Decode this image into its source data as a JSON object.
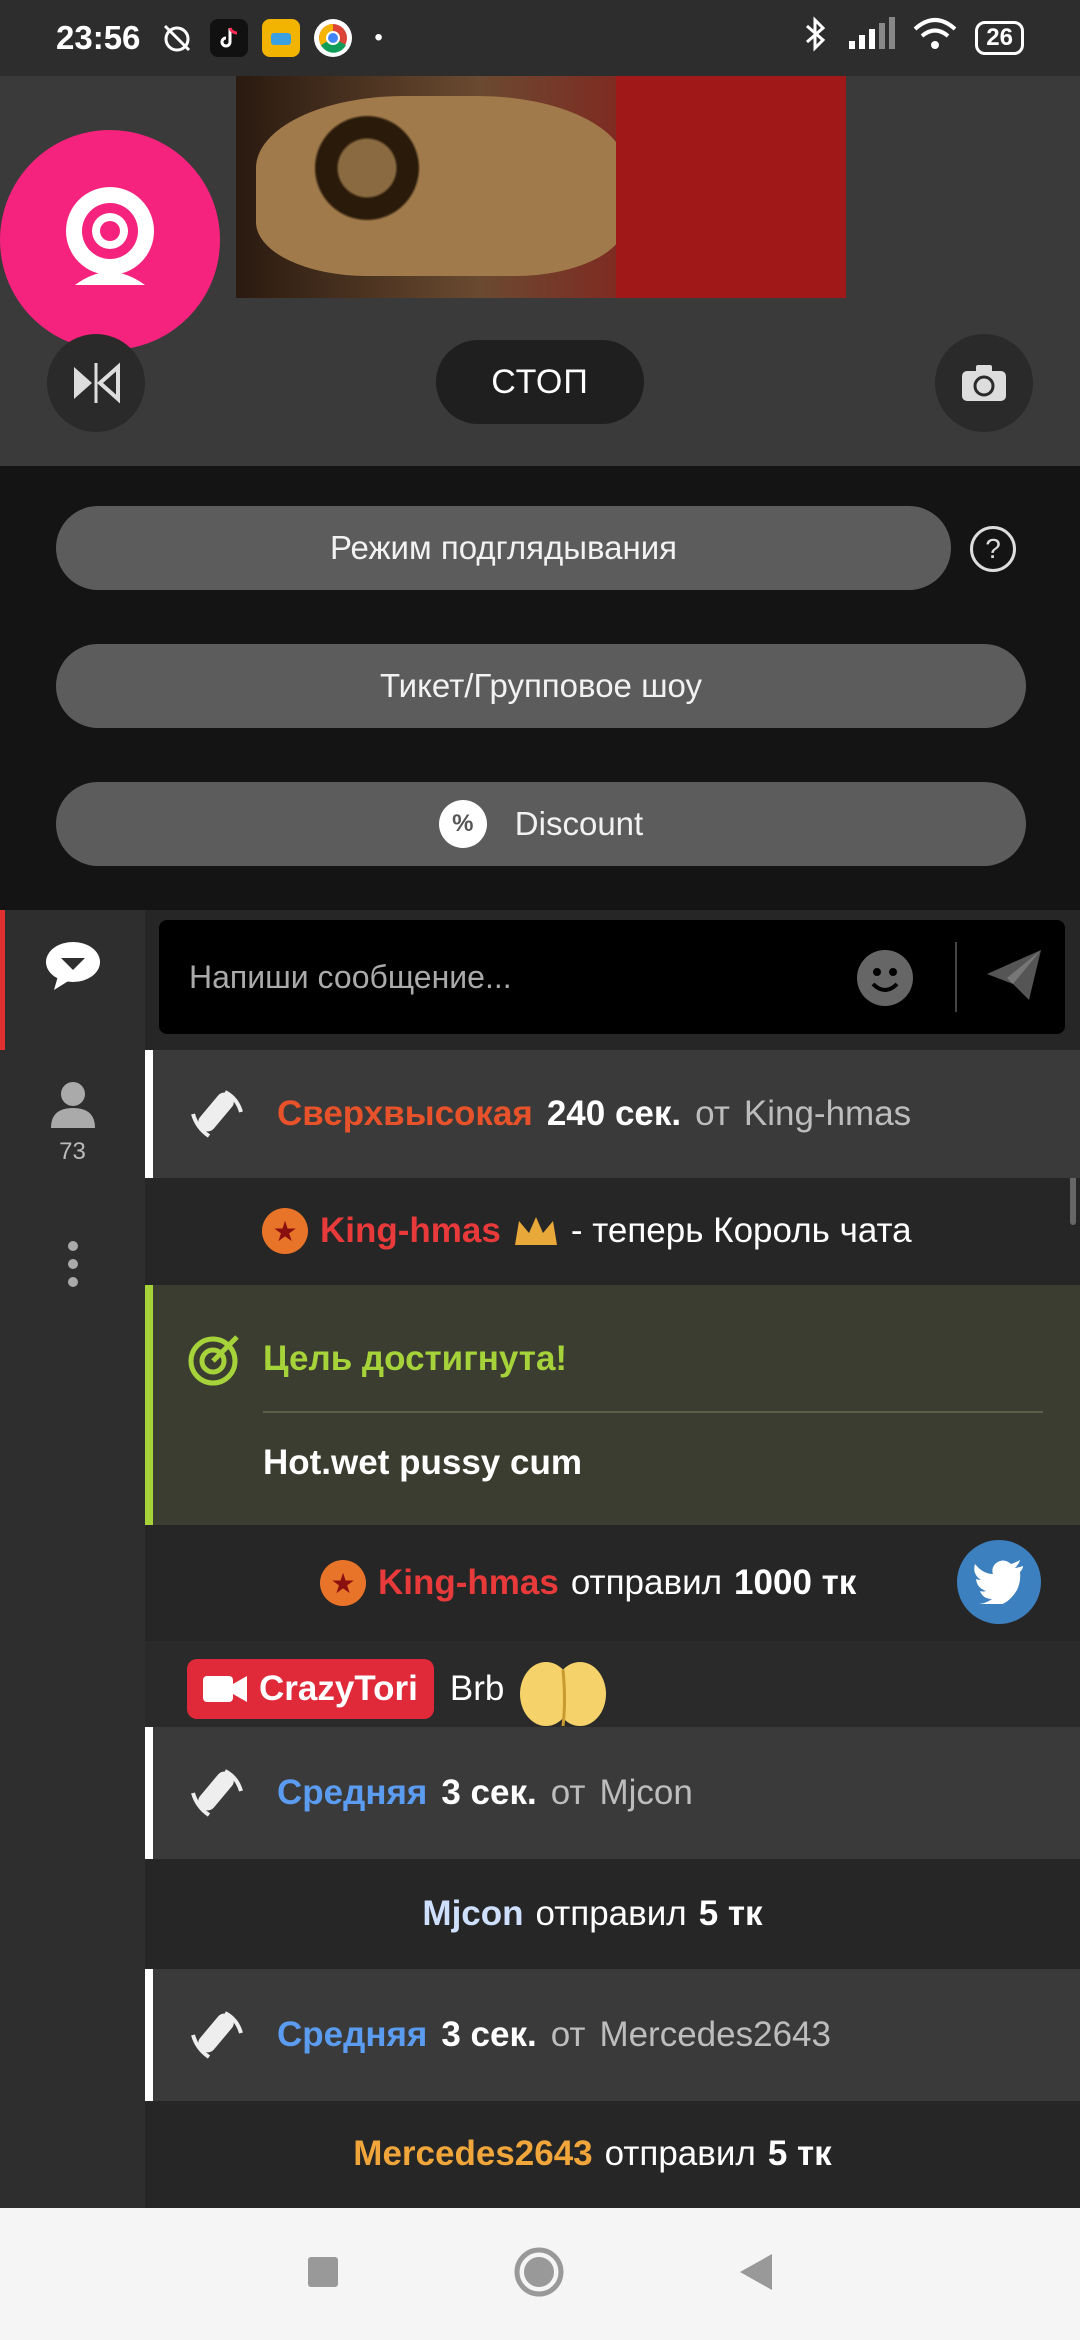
{
  "status_bar": {
    "time": "23:56",
    "battery": "26",
    "icons": [
      "muted-alarm-icon",
      "tiktok-icon",
      "app-icon",
      "chrome-icon",
      "bluetooth-icon",
      "signal-icon",
      "wifi-icon",
      "battery-icon"
    ]
  },
  "controls": {
    "stop_label": "СТОП"
  },
  "options": {
    "peek_mode": "Режим подглядывания",
    "help": "?",
    "ticket_show": "Тикет/Групповое шоу",
    "discount_icon": "%",
    "discount": "Discount"
  },
  "sidebar": {
    "users_count": "73"
  },
  "chat": {
    "input_placeholder": "Напиши сообщение...",
    "messages": [
      {
        "level": "Сверхвысокая",
        "duration": "240 сек.",
        "from_word": "от",
        "user": "King-hmas"
      },
      {
        "user": "King-hmas",
        "text": "- теперь Король чата"
      },
      {
        "goal_title": "Цель достигнута!",
        "goal_text": "Hot.wet pussy cum"
      },
      {
        "user": "King-hmas",
        "verb": "отправил",
        "amount": "1000 тк"
      },
      {
        "user": "CrazyTori",
        "text": "Brb"
      },
      {
        "level": "Средняя",
        "duration": "3 сек.",
        "from_word": "от",
        "user": "Mjcon"
      },
      {
        "user": "Mjcon",
        "verb": "отправил",
        "amount": "5 тк"
      },
      {
        "level": "Средняя",
        "duration": "3 сек.",
        "from_word": "от",
        "user": "Mercedes2643"
      },
      {
        "user": "Mercedes2643",
        "verb": "отправил",
        "amount": "5 тк"
      }
    ]
  },
  "colors": {
    "accent_pink": "#f5237d",
    "goal_green": "#a6d23a",
    "orange": "#e8522a",
    "blue": "#5b9cf0"
  }
}
